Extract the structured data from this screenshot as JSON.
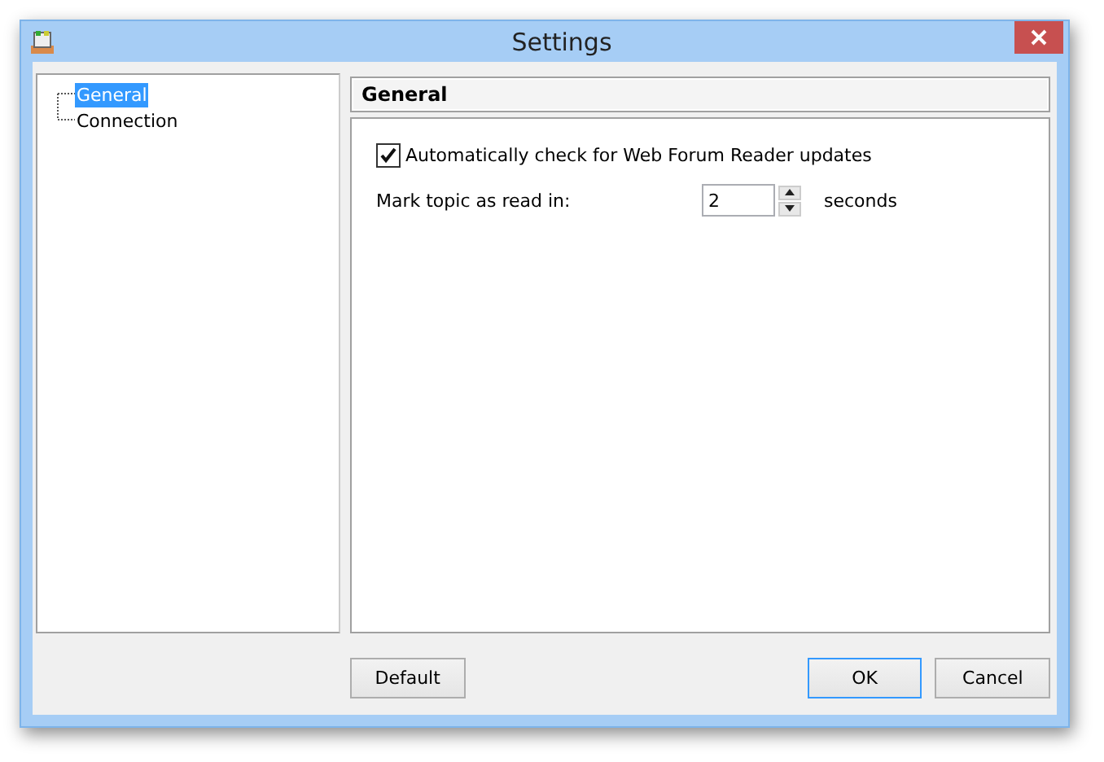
{
  "window": {
    "title": "Settings"
  },
  "tree": {
    "items": [
      {
        "label": "General",
        "selected": true
      },
      {
        "label": "Connection",
        "selected": false
      }
    ]
  },
  "panel": {
    "heading": "General",
    "auto_check": {
      "label": "Automatically check for Web Forum Reader updates",
      "checked": true
    },
    "mark_read": {
      "label": "Mark topic as read in:",
      "value": "2",
      "unit": "seconds"
    }
  },
  "buttons": [
    {
      "label": "Default",
      "focused": false
    },
    {
      "label": "OK",
      "focused": true
    },
    {
      "label": "Cancel",
      "focused": false
    }
  ]
}
